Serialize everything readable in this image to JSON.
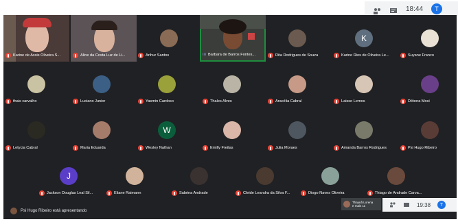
{
  "topbar": {
    "time": "18:44",
    "user_initial": "T"
  },
  "bottombar": {
    "time": "19:38",
    "user_initial": "T"
  },
  "presenting": "Psi Hugo Ribeiro está apresentando",
  "mini_tile": {
    "name": "Thaynã Lorena",
    "more": "e mais 11"
  },
  "participants": [
    "Karine de Assis Oliveira S...",
    "Aline da Costa Luz de Li...",
    "Arthur Santos",
    "Barbara de Barros Fontes...",
    "Rita Rodrigues de Souza",
    "Karine Rios de Oliveira Le...",
    "Suyane Franco",
    "thais carvalho",
    "Luciano Junior",
    "Yasmin Cardoso",
    "Thales Alves",
    "Aracélia Cabral",
    "Laisse Lemos",
    "Débora Mosi",
    "Letycia Cabral",
    "Maria Eduarda",
    "Wesley Nathan",
    "Emilly Freitas",
    "Julia Moraes",
    "Amanda Barros Rodrigues",
    "Psi Hugo Ribeiro",
    "Jackson Douglas Leal Sil...",
    "Eliane Raimann",
    "Sabrina Andrade",
    "Cleide Leandra da Silva F...",
    "Diogo Naves Oliveira",
    "Thiago de Andrade Carva..."
  ],
  "letters": {
    "karine_rios": "K",
    "wesley": "W",
    "jackson": "J"
  },
  "colors": {
    "screen_bg": "#202124",
    "mic_muted": "#ea4335",
    "active_speaker": "#1e8e3e"
  }
}
